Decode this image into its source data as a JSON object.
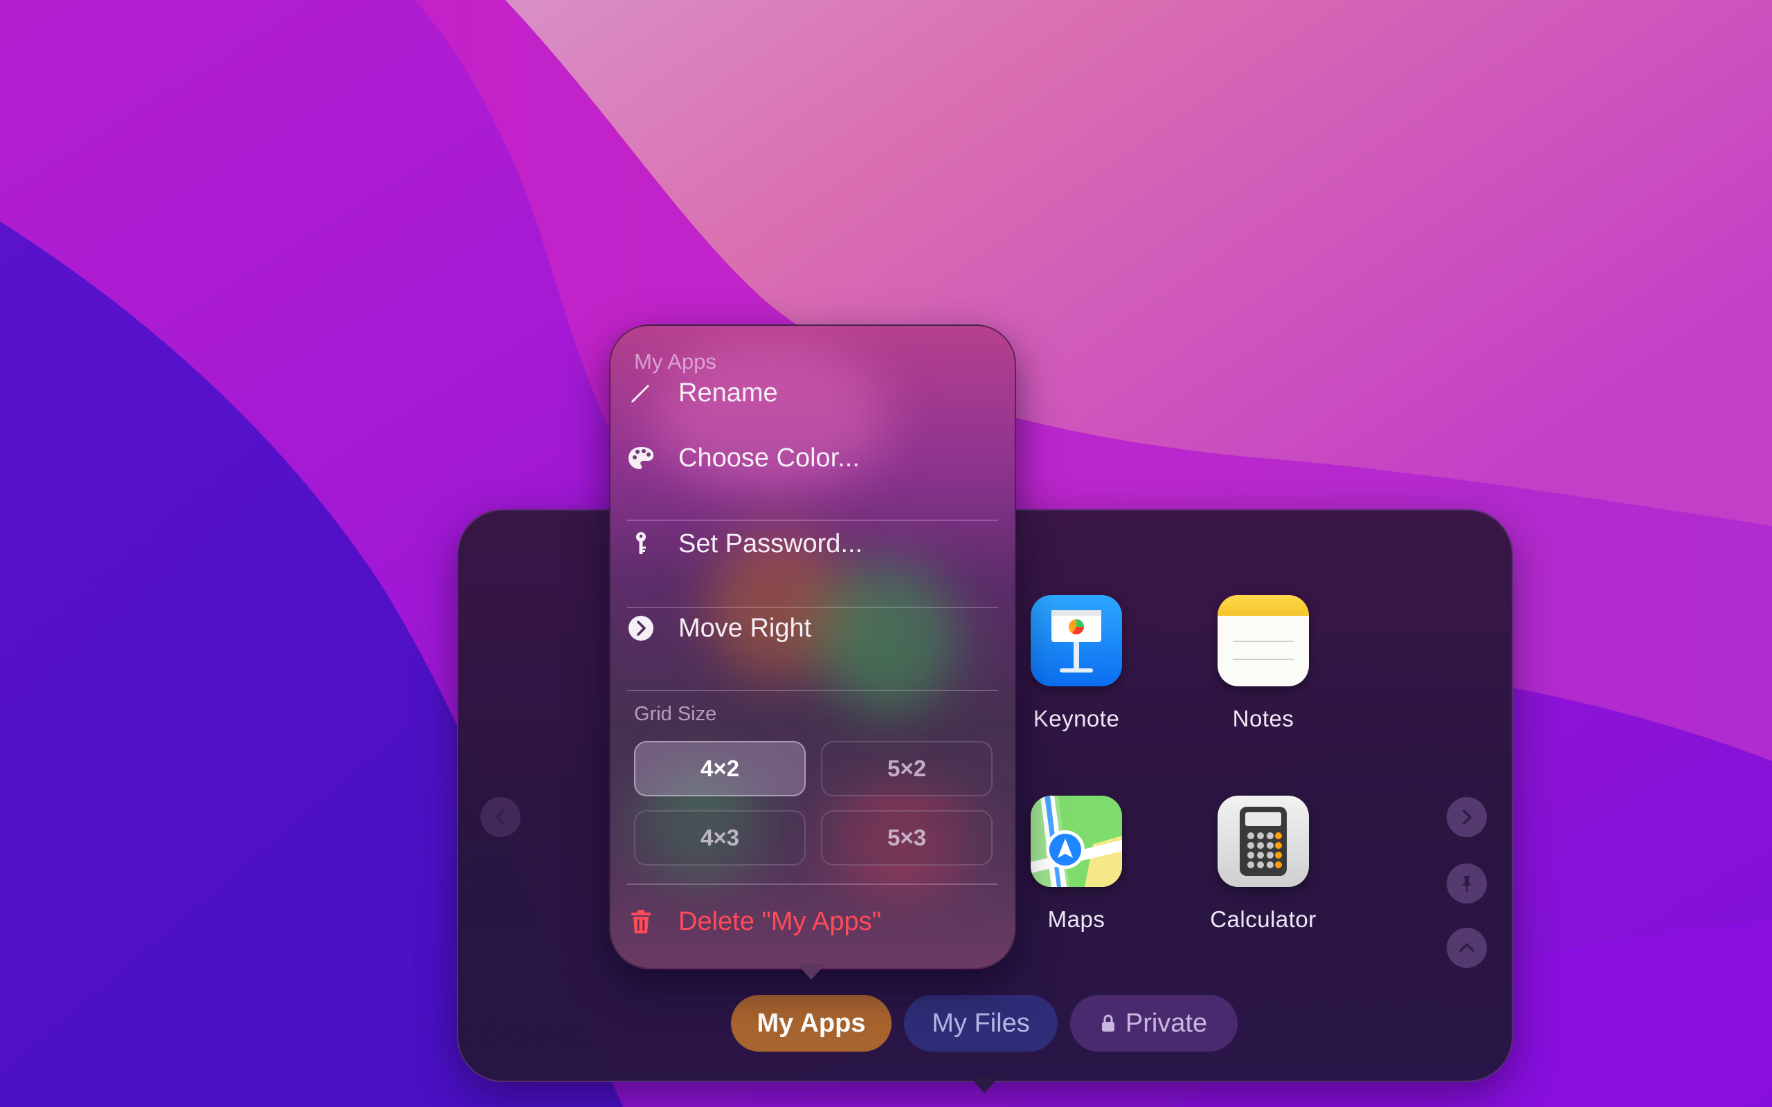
{
  "shelf": {
    "apps": [
      {
        "name": "Keynote",
        "icon": "keynote-icon"
      },
      {
        "name": "Notes",
        "icon": "notes-icon"
      },
      {
        "name": "Maps",
        "icon": "maps-icon"
      },
      {
        "name": "Calculator",
        "icon": "calculator-icon"
      }
    ],
    "tabs": {
      "my_apps": "My Apps",
      "my_files": "My Files",
      "private": "Private"
    },
    "colors": {
      "my_apps_tab": "#a8642e",
      "my_files_tab": "#2f2d78",
      "private_tab": "#4a2a6e"
    }
  },
  "menu": {
    "header": "My Apps",
    "rename": "Rename",
    "choose_color": "Choose Color...",
    "set_password": "Set Password...",
    "move_right": "Move Right",
    "grid_size_header": "Grid Size",
    "grid_options": [
      "4×2",
      "5×2",
      "4×3",
      "5×3"
    ],
    "selected_grid": "4×2",
    "delete": "Delete \"My Apps\"",
    "delete_color": "#ff4a5a"
  }
}
